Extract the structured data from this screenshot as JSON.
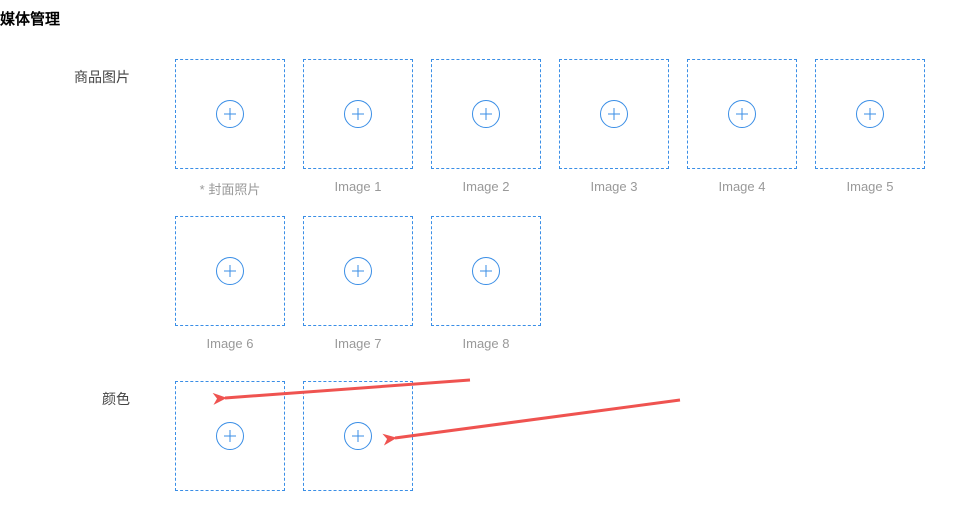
{
  "page_title": "媒体管理",
  "sections": {
    "product_images": {
      "label": "商品图片",
      "slots": [
        {
          "caption": "* 封面照片"
        },
        {
          "caption": "Image 1"
        },
        {
          "caption": "Image 2"
        },
        {
          "caption": "Image 3"
        },
        {
          "caption": "Image 4"
        },
        {
          "caption": "Image 5"
        },
        {
          "caption": "Image 6"
        },
        {
          "caption": "Image 7"
        },
        {
          "caption": "Image 8"
        }
      ]
    },
    "color": {
      "label": "颜色",
      "slots": [
        {
          "caption": ""
        },
        {
          "caption": ""
        }
      ]
    }
  },
  "colors": {
    "accent": "#3a8ee6",
    "annotation_arrow": "#ef5350"
  }
}
